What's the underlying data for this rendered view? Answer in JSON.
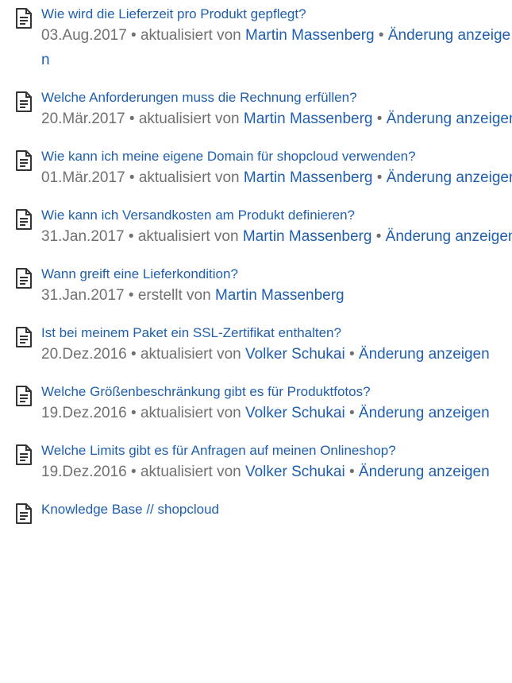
{
  "items": [
    {
      "title": "Wie wird die Lieferzeit pro Produkt gepflegt?",
      "date": "03.Aug.2017",
      "bullet": "•",
      "action": "aktualisiert von",
      "author": "Martin Massenberg",
      "change": "Änderung anzeigen"
    },
    {
      "title": "Welche Anforderungen muss die Rechnung erfüllen?",
      "date": "20.Mär.2017",
      "bullet": "•",
      "action": "aktualisiert von",
      "author": "Martin Massenberg",
      "change": "Änderung anzeigen"
    },
    {
      "title": "Wie kann ich meine eigene Domain für shopcloud verwenden?",
      "date": "01.Mär.2017",
      "bullet": "•",
      "action": "aktualisiert von",
      "author": "Martin Massenberg",
      "change": "Änderung anzeigen"
    },
    {
      "title": "Wie kann ich Versandkosten am Produkt definieren?",
      "date": "31.Jan.2017",
      "bullet": "•",
      "action": "aktualisiert von",
      "author": "Martin Massenberg",
      "change": "Änderung anzeigen"
    },
    {
      "title": "Wann greift eine Lieferkondition?",
      "date": "31.Jan.2017",
      "bullet": "•",
      "action": "erstellt von",
      "author": "Martin Massenberg"
    },
    {
      "title": "Ist bei meinem Paket ein SSL-Zertifikat enthalten?",
      "date": "20.Dez.2016",
      "bullet": "•",
      "action": "aktualisiert von",
      "author": "Volker Schukai",
      "change": "Änderung anzeigen"
    },
    {
      "title": "Welche Größenbeschränkung gibt es für Produktfotos?",
      "date": "19.Dez.2016",
      "bullet": "•",
      "action": "aktualisiert von",
      "author": "Volker Schukai",
      "change": "Änderung anzeigen"
    },
    {
      "title": "Welche Limits gibt es für Anfragen auf meinen Onlineshop?",
      "date": "19.Dez.2016",
      "bullet": "•",
      "action": "aktualisiert von",
      "author": "Volker Schukai",
      "change": "Änderung anzeigen"
    },
    {
      "title": "Knowledge Base // shopcloud"
    }
  ],
  "icon": "page-icon",
  "link_color": "#1f5fae",
  "meta_color": "#707070"
}
